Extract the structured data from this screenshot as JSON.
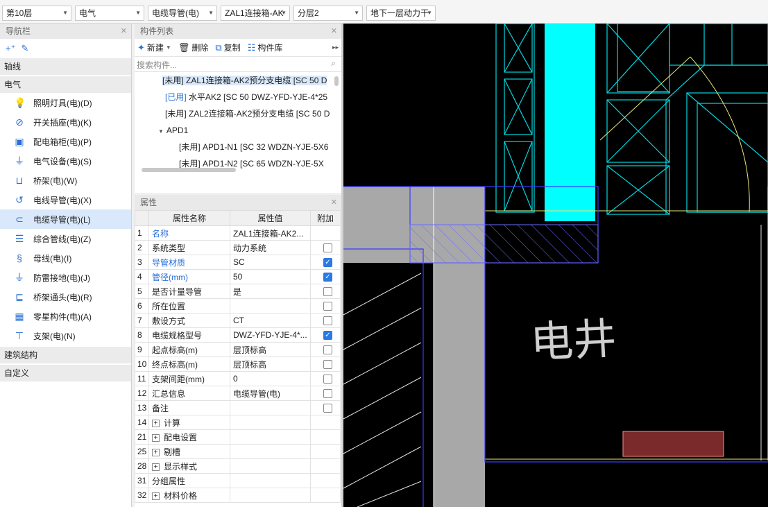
{
  "topbar": {
    "floor": "第10层",
    "discipline": "电气",
    "type": "电缆导管(电)",
    "component": "ZAL1连接箱-AK",
    "layer": "分层2",
    "system": "地下一层动力干"
  },
  "nav": {
    "title": "导航栏",
    "groups": {
      "axis": "轴线",
      "elec": "电气",
      "struct": "建筑结构",
      "custom": "自定义"
    },
    "items": [
      {
        "label": "照明灯具(电)(D)",
        "icon": "bulb-icon"
      },
      {
        "label": "开关插座(电)(K)",
        "icon": "switch-icon"
      },
      {
        "label": "配电箱柜(电)(P)",
        "icon": "distribution-box-icon"
      },
      {
        "label": "电气设备(电)(S)",
        "icon": "plug-icon"
      },
      {
        "label": "桥架(电)(W)",
        "icon": "tray-icon"
      },
      {
        "label": "电线导管(电)(X)",
        "icon": "wire-conduit-icon"
      },
      {
        "label": "电缆导管(电)(L)",
        "icon": "cable-conduit-icon"
      },
      {
        "label": "综合管线(电)(Z)",
        "icon": "pipeline-icon"
      },
      {
        "label": "母线(电)(I)",
        "icon": "busbar-icon"
      },
      {
        "label": "防雷接地(电)(J)",
        "icon": "ground-icon"
      },
      {
        "label": "桥架通头(电)(R)",
        "icon": "tray-fitting-icon"
      },
      {
        "label": "零星构件(电)(A)",
        "icon": "misc-icon"
      },
      {
        "label": "支架(电)(N)",
        "icon": "bracket-icon"
      }
    ]
  },
  "components": {
    "title": "构件列表",
    "toolbar": {
      "new": "新建",
      "delete": "删除",
      "copy": "复制",
      "library": "构件库"
    },
    "search_placeholder": "搜索构件...",
    "tree": [
      {
        "tag": "[未用]",
        "text": "ZAL1连接箱-AK2预分支电缆 [SC 50 D"
      },
      {
        "tag": "[已用]",
        "text": "水平AK2 [SC 50 DWZ-YFD-YJE-4*25"
      },
      {
        "tag": "[未用]",
        "text": "ZAL2连接箱-AK2预分支电缆 [SC 50 D"
      },
      {
        "tag": "",
        "text": "APD1"
      },
      {
        "tag": "[未用]",
        "text": "APD1-N1 [SC 32 WDZN-YJE-5X6"
      },
      {
        "tag": "[未用]",
        "text": "APD1-N2 [SC 65 WDZN-YJE-5X"
      }
    ]
  },
  "props": {
    "title": "属性",
    "headers": {
      "name": "属性名称",
      "value": "属性值",
      "extra": "附加"
    },
    "rows": [
      {
        "n": "1",
        "name": "名称",
        "value": "ZAL1连接箱-AK2..."
      },
      {
        "n": "2",
        "name": "系统类型",
        "value": "动力系统"
      },
      {
        "n": "3",
        "name": "导管材质",
        "value": "SC"
      },
      {
        "n": "4",
        "name": "管径(mm)",
        "value": "50"
      },
      {
        "n": "5",
        "name": "是否计量导管",
        "value": "是"
      },
      {
        "n": "6",
        "name": "所在位置",
        "value": ""
      },
      {
        "n": "7",
        "name": "敷设方式",
        "value": "CT"
      },
      {
        "n": "8",
        "name": "电缆规格型号",
        "value": "DWZ-YFD-YJE-4*..."
      },
      {
        "n": "9",
        "name": "起点标高(m)",
        "value": "层顶标高"
      },
      {
        "n": "10",
        "name": "终点标高(m)",
        "value": "层顶标高"
      },
      {
        "n": "11",
        "name": "支架间距(mm)",
        "value": "0"
      },
      {
        "n": "12",
        "name": "汇总信息",
        "value": "电缆导管(电)"
      },
      {
        "n": "13",
        "name": "备注",
        "value": ""
      },
      {
        "n": "14",
        "name": "计算",
        "value": ""
      },
      {
        "n": "21",
        "name": "配电设置",
        "value": ""
      },
      {
        "n": "25",
        "name": "剔槽",
        "value": ""
      },
      {
        "n": "28",
        "name": "显示样式",
        "value": ""
      },
      {
        "n": "31",
        "name": "分组属性",
        "value": ""
      },
      {
        "n": "32",
        "name": "材料价格",
        "value": ""
      }
    ]
  },
  "canvas": {
    "label": "电井"
  }
}
